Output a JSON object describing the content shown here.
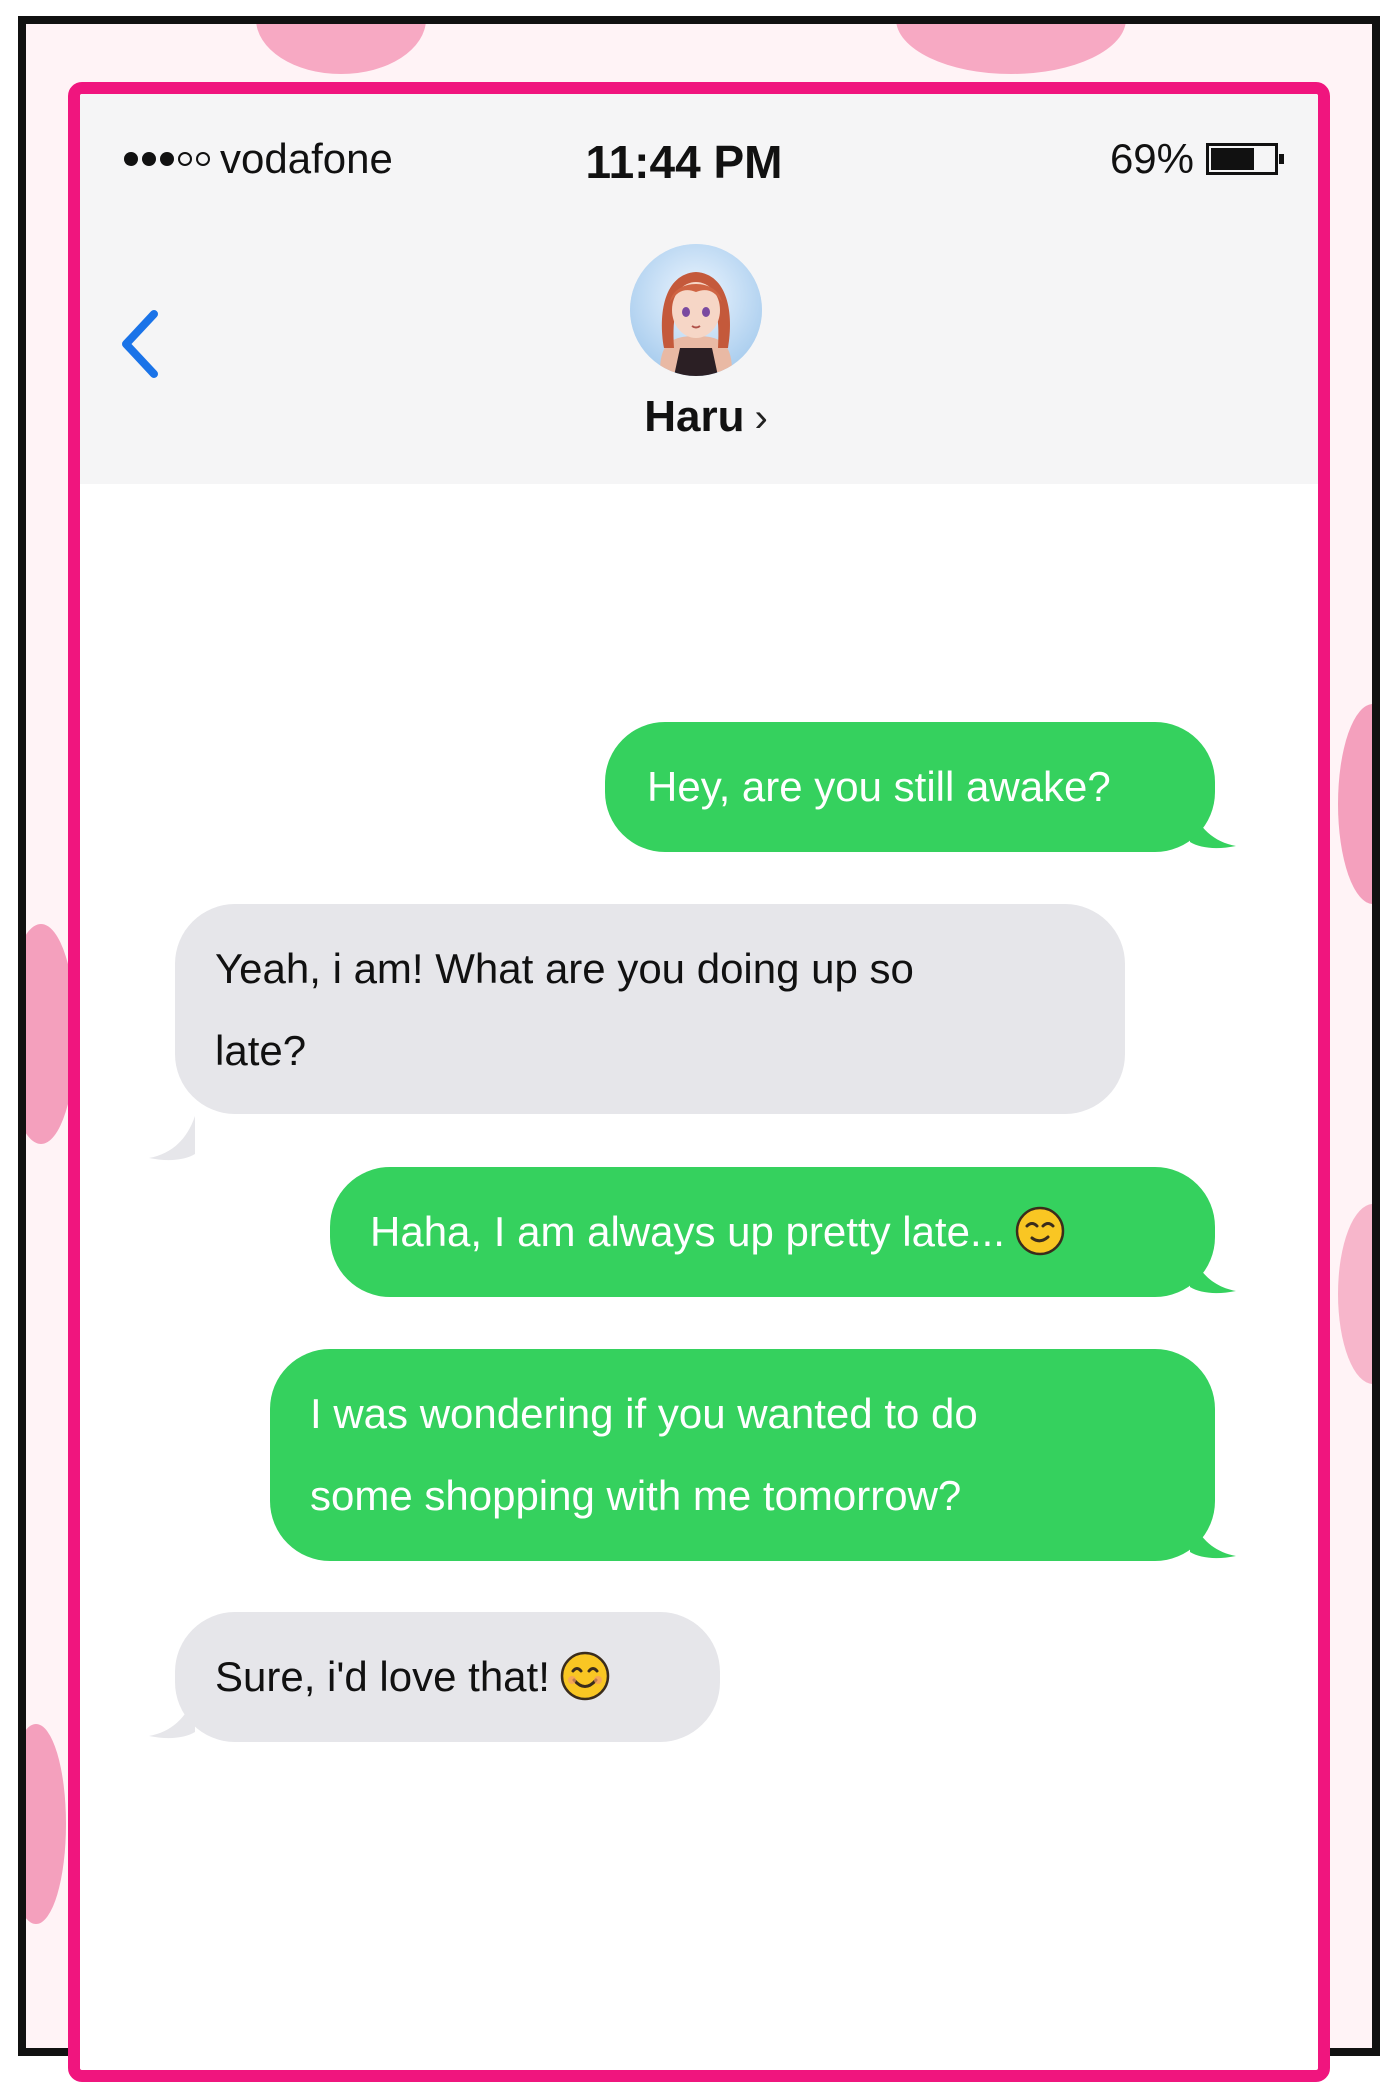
{
  "status_bar": {
    "carrier": "vodafone",
    "signal_bars_filled": 3,
    "signal_bars_total": 5,
    "time": "11:44 PM",
    "battery_label": "69%",
    "battery_level": 0.69
  },
  "header": {
    "contact_name": "Haru",
    "contact_chevron": "›",
    "back_icon": "chevron-left-icon"
  },
  "messages": [
    {
      "direction": "out",
      "text": "Hey, are you still awake?"
    },
    {
      "direction": "in",
      "text_lines": [
        "Yeah, i am! What are you doing up so",
        "late?"
      ]
    },
    {
      "direction": "out",
      "text": "Haha, I am always up pretty late...",
      "emoji": "smirk-emoji"
    },
    {
      "direction": "out",
      "text_lines": [
        "I was wondering if you wanted to do",
        "some shopping with me tomorrow?"
      ]
    },
    {
      "direction": "in",
      "text": "Sure, i'd love that!",
      "emoji": "smile-emoji"
    }
  ],
  "colors": {
    "frame_pink": "#f0157e",
    "outgoing_bubble": "#35d15e",
    "incoming_bubble": "#e6e6ea",
    "ios_blue": "#1a73e8"
  }
}
